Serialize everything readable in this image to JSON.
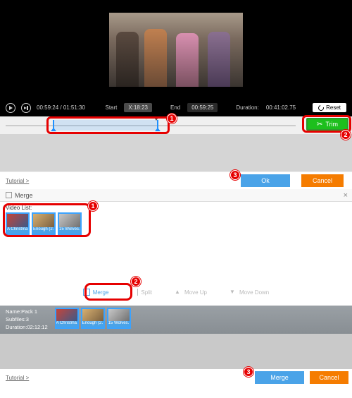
{
  "video": {
    "current_time": "00:59:24",
    "total_time": "01:51:30",
    "start_label": "Start",
    "start_value": "X:18:23",
    "end_label": "End",
    "end_value": "00:59:25",
    "duration_label": "Duration:",
    "duration_value": "00:41:02.75",
    "reset_label": "Reset",
    "trim_label": "Trim"
  },
  "badges": {
    "n1": "1",
    "n2": "2",
    "n3": "3"
  },
  "footer": {
    "tutorial": "Tutorial >",
    "ok": "Ok",
    "cancel": "Cancel",
    "merge": "Merge"
  },
  "merge_panel": {
    "title": "Merge",
    "video_list_label": "Video List:",
    "thumbs": [
      {
        "cap": "A Christma…"
      },
      {
        "cap": "Enough (2…"
      },
      {
        "cap": "15 Wolves…"
      }
    ],
    "actions": {
      "merge": "Merge",
      "split": "Split",
      "move_up": "Move Up",
      "move_down": "Move Down"
    }
  },
  "pack": {
    "name_label": "Name:",
    "name_value": "Pack 1",
    "subfiles_label": "Subfiles:",
    "subfiles_value": "3",
    "duration_label": "Duration:",
    "duration_value": "02:12:12"
  }
}
